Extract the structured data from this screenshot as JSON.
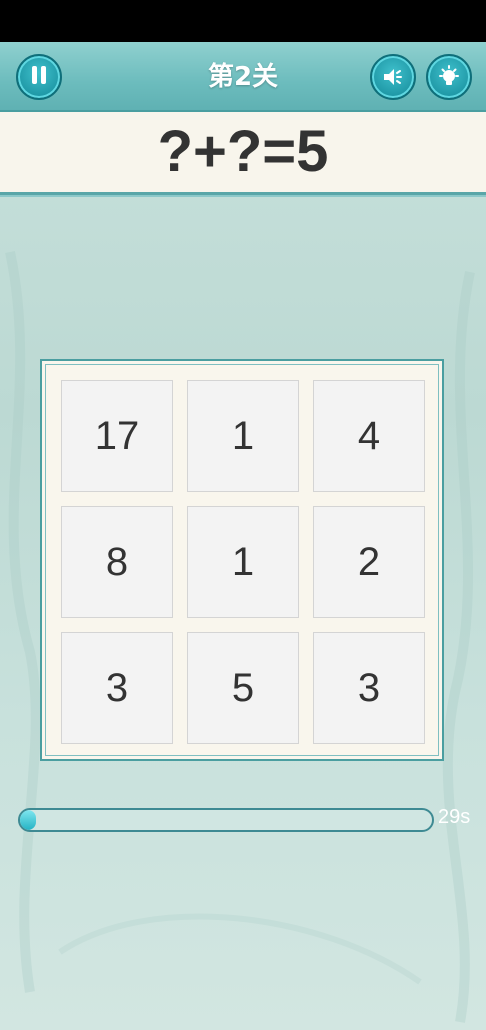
{
  "header": {
    "level_title": "第2关",
    "pause_icon": "pause-icon",
    "sound_icon": "speaker-muted-icon",
    "hint_icon": "lightbulb-icon"
  },
  "puzzle": {
    "equation": "?+?=5"
  },
  "grid": {
    "tiles": [
      "17",
      "1",
      "4",
      "8",
      "1",
      "2",
      "3",
      "5",
      "3"
    ]
  },
  "timer": {
    "label": "29s",
    "progress_fraction": 0.04
  },
  "colors": {
    "accent": "#1f98a6",
    "topbar": "#6cbcbd",
    "board_bg": "#f9f6ed",
    "tile_bg": "#f3f3f3"
  }
}
